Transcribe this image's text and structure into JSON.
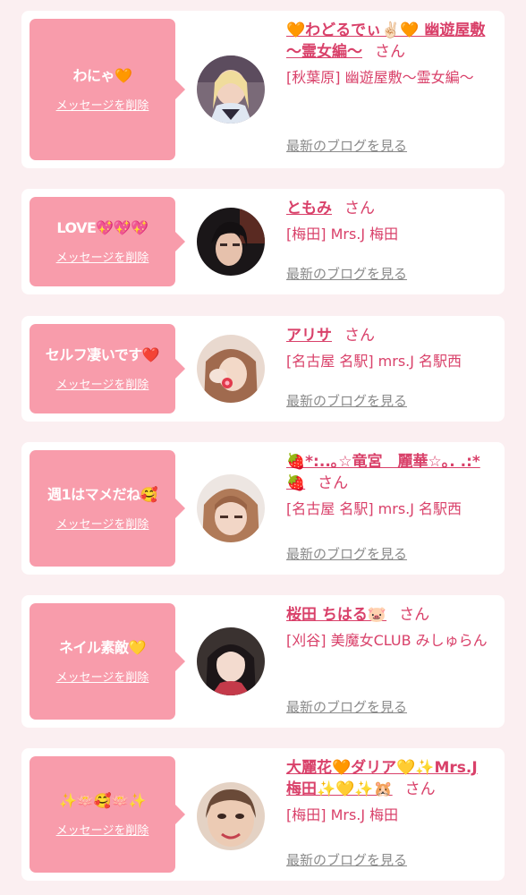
{
  "entries": [
    {
      "comment": "わにゃ🧡",
      "delete_label": "メッセージを削除",
      "name": "🧡わどるでぃ✌🏻🧡 幽遊屋敷 〜霊女編〜",
      "suffix": "さん",
      "shop": "[秋葉原] 幽遊屋敷〜霊女編〜",
      "blog_link": "最新のブログを見る"
    },
    {
      "comment": "LOVE💖💖💖",
      "delete_label": "メッセージを削除",
      "name": "ともみ",
      "suffix": "さん",
      "shop": "[梅田] Mrs.J 梅田",
      "blog_link": "最新のブログを見る"
    },
    {
      "comment": "セルフ凄いです❤️",
      "delete_label": "メッセージを削除",
      "name": "アリサ",
      "suffix": "さん",
      "shop": "[名古屋 名駅] mrs.J 名駅西",
      "blog_link": "最新のブログを見る"
    },
    {
      "comment": "週1はマメだね🥰",
      "delete_label": "メッセージを削除",
      "name": "🍓*:..｡☆竜宮　麗華☆｡. .:*🍓",
      "suffix": "さん",
      "shop": "[名古屋 名駅] mrs.J 名駅西",
      "blog_link": "最新のブログを見る"
    },
    {
      "comment": "ネイル素敵💛",
      "delete_label": "メッセージを削除",
      "name": "桜田 ちはる🐷",
      "suffix": "さん",
      "shop": "[刈谷] 美魔女CLUB みしゅらん",
      "blog_link": "最新のブログを見る"
    },
    {
      "comment": "✨🪷🥰🪷✨",
      "delete_label": "メッセージを削除",
      "name": "大麗花🧡ダリア💛✨Mrs.J 梅田✨💛✨🐹",
      "suffix": "さん",
      "shop": "[梅田] Mrs.J 梅田",
      "blog_link": "最新のブログを見る"
    }
  ],
  "colors": {
    "page_background": "#fbeff1",
    "bubble": "#f89cab",
    "accent_text": "#d9416a",
    "link_gray": "#8a8a8a"
  }
}
